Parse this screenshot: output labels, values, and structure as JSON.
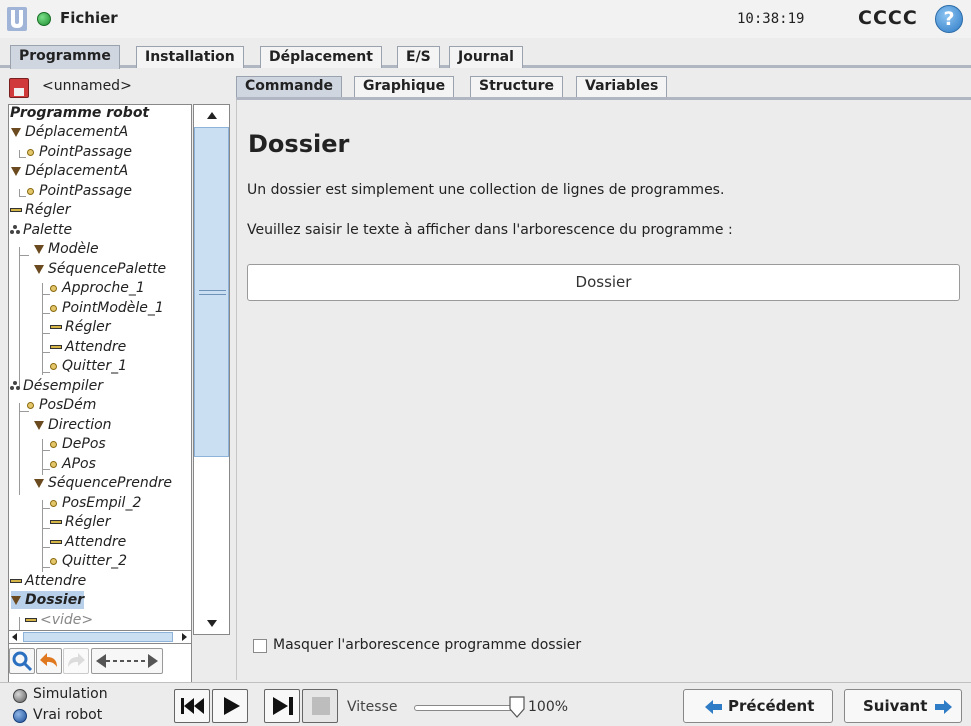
{
  "topbar": {
    "menu_label": "Fichier",
    "clock": "10:38:19",
    "robot_name": "CCCC",
    "help_glyph": "?"
  },
  "main_tabs": [
    {
      "label": "Programme",
      "active": true
    },
    {
      "label": "Installation",
      "active": false
    },
    {
      "label": "Déplacement",
      "active": false
    },
    {
      "label": "E/S",
      "active": false
    },
    {
      "label": "Journal",
      "active": false
    }
  ],
  "file": {
    "name": "<unnamed>"
  },
  "tree": [
    {
      "label": "Programme robot",
      "icon": "none"
    },
    {
      "label": "DéplacementA",
      "icon": "triangle-icon"
    },
    {
      "label": "PointPassage",
      "icon": "waypoint-icon"
    },
    {
      "label": "DéplacementA",
      "icon": "triangle-icon"
    },
    {
      "label": "PointPassage",
      "icon": "waypoint-icon"
    },
    {
      "label": "Régler",
      "icon": "bar-icon"
    },
    {
      "label": "Palette",
      "icon": "pallet-icon"
    },
    {
      "label": "Modèle",
      "icon": "triangle-icon"
    },
    {
      "label": "SéquencePalette",
      "icon": "triangle-icon"
    },
    {
      "label": "Approche_1",
      "icon": "waypoint-icon"
    },
    {
      "label": "PointModèle_1",
      "icon": "waypoint-icon"
    },
    {
      "label": "Régler",
      "icon": "bar-icon"
    },
    {
      "label": "Attendre",
      "icon": "bar-icon"
    },
    {
      "label": "Quitter_1",
      "icon": "waypoint-icon"
    },
    {
      "label": "Désempiler",
      "icon": "pallet-icon"
    },
    {
      "label": "PosDém",
      "icon": "waypoint-icon"
    },
    {
      "label": "Direction",
      "icon": "triangle-icon"
    },
    {
      "label": "DePos",
      "icon": "waypoint-icon"
    },
    {
      "label": "APos",
      "icon": "waypoint-icon"
    },
    {
      "label": "SéquencePrendre",
      "icon": "triangle-icon"
    },
    {
      "label": "PosEmpil_2",
      "icon": "waypoint-icon"
    },
    {
      "label": "Régler",
      "icon": "bar-icon"
    },
    {
      "label": "Attendre",
      "icon": "bar-icon"
    },
    {
      "label": "Quitter_2",
      "icon": "waypoint-icon"
    },
    {
      "label": "Attendre",
      "icon": "bar-icon"
    },
    {
      "label": "Dossier",
      "icon": "triangle-icon",
      "selected": true
    },
    {
      "label": "<vide>",
      "icon": "bar-icon"
    }
  ],
  "sub_tabs": [
    {
      "label": "Commande",
      "active": true
    },
    {
      "label": "Graphique",
      "active": false
    },
    {
      "label": "Structure",
      "active": false
    },
    {
      "label": "Variables",
      "active": false
    }
  ],
  "content": {
    "title": "Dossier",
    "description": "Un dossier est simplement une collection de lignes de programmes.",
    "prompt": "Veuillez saisir le texte à afficher dans l'arborescence du programme :",
    "folder_name_value": "Dossier",
    "hide_checkbox_label": "Masquer l'arborescence programme dossier",
    "hide_checked": false
  },
  "bottombar": {
    "mode_simulation": "Simulation",
    "mode_real": "Vrai robot",
    "speed_label": "Vitesse",
    "speed_value": "100%",
    "speed_fraction": 1.0,
    "prev_label": "Précédent",
    "next_label": "Suivant"
  },
  "colors": {
    "accent": "#cfd6e0",
    "selection": "#b8d0ea",
    "scroll": "#cbdff3"
  }
}
